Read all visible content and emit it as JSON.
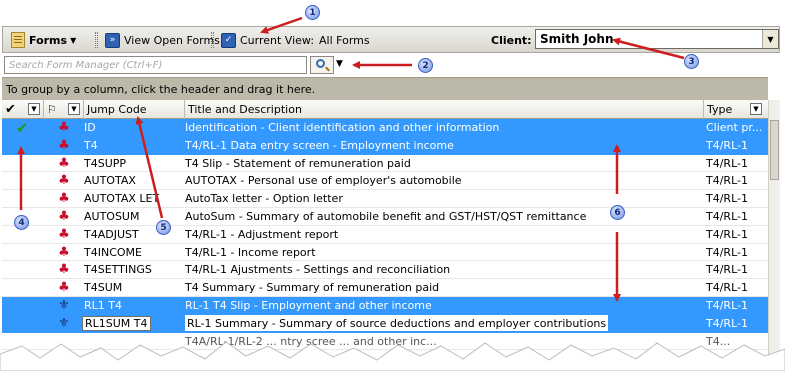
{
  "toolbar": {
    "forms_label": "Forms",
    "view_open_forms": "View Open Forms",
    "current_view_label": "Current View:",
    "current_view_value": "All Forms",
    "client_label": "Client:",
    "client_value": "Smith John"
  },
  "search": {
    "placeholder": "Search Form Manager (Ctrl+F)"
  },
  "group_panel": {
    "text": "To group by a column, click the header and drag it here."
  },
  "grid": {
    "columns": {
      "check": "✔",
      "flag": "⚐",
      "jump": "Jump Code",
      "title": "Title and Description",
      "type": "Type"
    },
    "rows": [
      {
        "jump": "ID",
        "title": "Identification - Client identification and other information",
        "type": "Client pr..."
      },
      {
        "jump": "T4",
        "title": "T4/RL-1 Data entry screen - Employment income",
        "type": "T4/RL-1"
      },
      {
        "jump": "T4SUPP",
        "title": "T4 Slip - Statement of remuneration paid",
        "type": "T4/RL-1"
      },
      {
        "jump": "AUTOTAX",
        "title": "AUTOTAX - Personal use of employer's automobile",
        "type": "T4/RL-1"
      },
      {
        "jump": "AUTOTAX LET",
        "title": "AutoTax letter - Option letter",
        "type": "T4/RL-1"
      },
      {
        "jump": "AUTOSUM",
        "title": "AutoSum - Summary of automobile benefit and GST/HST/QST remittance",
        "type": "T4/RL-1"
      },
      {
        "jump": "T4ADJUST",
        "title": "T4/RL-1 - Adjustment report",
        "type": "T4/RL-1"
      },
      {
        "jump": "T4INCOME",
        "title": "T4/RL-1 - Income report",
        "type": "T4/RL-1"
      },
      {
        "jump": "T4SETTINGS",
        "title": "T4/RL-1 Ajustments - Settings and reconciliation",
        "type": "T4/RL-1"
      },
      {
        "jump": "T4SUM",
        "title": "T4 Summary - Summary of remuneration paid",
        "type": "T4/RL-1"
      },
      {
        "jump": "RL1 T4",
        "title": "RL-1 T4 Slip - Employment and other income",
        "type": "T4/RL-1"
      },
      {
        "jump": "RL1SUM T4",
        "title": "RL-1 Summary - Summary of source deductions and employer contributions",
        "type": "T4/RL-1"
      },
      {
        "jump": "",
        "title": "T4A/RL-1/RL-2 ... ntry scree ... and other inc...",
        "type": "T4..."
      }
    ]
  },
  "callouts": [
    "1",
    "2",
    "3",
    "4",
    "5",
    "6"
  ],
  "colors": {
    "selection": "#3399ff",
    "arrow": "#cc1e1e",
    "callout": "#6f90e6",
    "toolbar": "#d9d7cf",
    "group_panel": "#bdb9a8"
  },
  "icons": [
    "forms-icon",
    "view-open-forms-icon",
    "current-view-icon",
    "search-icon",
    "check-icon",
    "maple-leaf-icon",
    "fleur-de-lis-icon"
  ]
}
